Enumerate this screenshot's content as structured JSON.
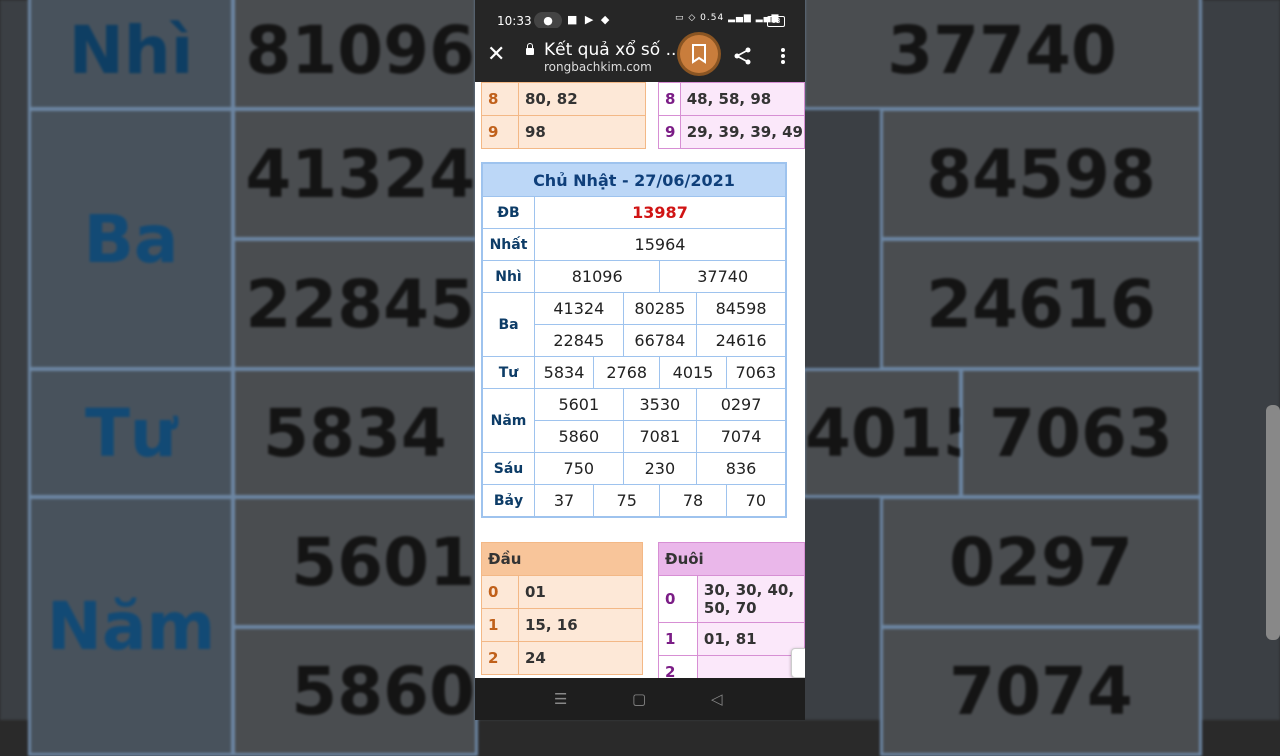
{
  "background": {
    "cells": [
      "Nhì",
      "81096",
      "37740",
      "41324",
      "84598",
      "Ba",
      "22845",
      "24616",
      "Tư",
      "5834",
      "4015",
      "7063",
      "5601",
      "0297",
      "Năm",
      "5860",
      "7074"
    ]
  },
  "status_bar": {
    "time": "10:33",
    "net_speed": "0.54",
    "battery": "63"
  },
  "browser": {
    "title": "Kết quả xổ số ...",
    "url": "rongbachkim.com"
  },
  "top_dau": [
    {
      "k": "8",
      "v": "80, 82"
    },
    {
      "k": "9",
      "v": "98"
    }
  ],
  "top_duoi": [
    {
      "k": "8",
      "v": "48, 58, 98"
    },
    {
      "k": "9",
      "v": "29, 39, 39, 49"
    }
  ],
  "results": {
    "header": "Chủ Nhật - 27/06/2021",
    "db_label": "ĐB",
    "db": "13987",
    "nhat_label": "Nhất",
    "nhat": "15964",
    "nhi_label": "Nhì",
    "nhi": [
      "81096",
      "37740"
    ],
    "ba_label": "Ba",
    "ba": [
      "41324",
      "80285",
      "84598",
      "22845",
      "66784",
      "24616"
    ],
    "tu_label": "Tư",
    "tu": [
      "5834",
      "2768",
      "4015",
      "7063"
    ],
    "nam_label": "Năm",
    "nam": [
      "5601",
      "3530",
      "0297",
      "5860",
      "7081",
      "7074"
    ],
    "sau_label": "Sáu",
    "sau": [
      "750",
      "230",
      "836"
    ],
    "bay_label": "Bảy",
    "bay": [
      "37",
      "75",
      "78",
      "70"
    ]
  },
  "dau_table": {
    "header": "Đầu",
    "rows": [
      {
        "k": "0",
        "v": "01"
      },
      {
        "k": "1",
        "v": "15, 16"
      },
      {
        "k": "2",
        "v": "24"
      }
    ]
  },
  "duoi_table": {
    "header": "Đuôi",
    "rows": [
      {
        "k": "0",
        "v": "30, 30, 40, 50, 70"
      },
      {
        "k": "1",
        "v": "01, 81"
      },
      {
        "k": "2",
        "v": ""
      }
    ]
  },
  "colors": {
    "db_red": "#d01414",
    "header_blue": "#bcd7f7",
    "dau_orange": "#fde8d7",
    "duoi_purple": "#fbe8fa"
  }
}
